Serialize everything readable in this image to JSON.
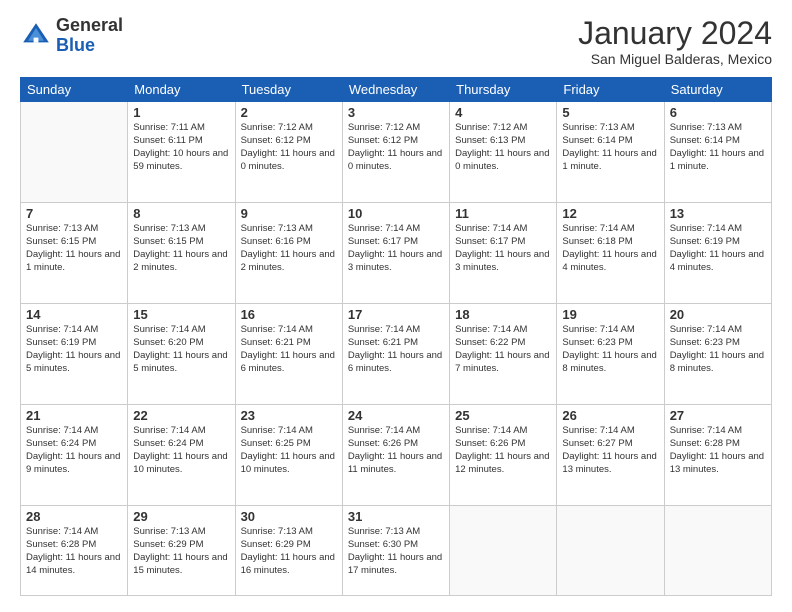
{
  "logo": {
    "general": "General",
    "blue": "Blue"
  },
  "header": {
    "month": "January 2024",
    "location": "San Miguel Balderas, Mexico"
  },
  "days": [
    "Sunday",
    "Monday",
    "Tuesday",
    "Wednesday",
    "Thursday",
    "Friday",
    "Saturday"
  ],
  "weeks": [
    [
      {
        "num": "",
        "info": ""
      },
      {
        "num": "1",
        "info": "Sunrise: 7:11 AM\nSunset: 6:11 PM\nDaylight: 10 hours\nand 59 minutes."
      },
      {
        "num": "2",
        "info": "Sunrise: 7:12 AM\nSunset: 6:12 PM\nDaylight: 11 hours\nand 0 minutes."
      },
      {
        "num": "3",
        "info": "Sunrise: 7:12 AM\nSunset: 6:12 PM\nDaylight: 11 hours\nand 0 minutes."
      },
      {
        "num": "4",
        "info": "Sunrise: 7:12 AM\nSunset: 6:13 PM\nDaylight: 11 hours\nand 0 minutes."
      },
      {
        "num": "5",
        "info": "Sunrise: 7:13 AM\nSunset: 6:14 PM\nDaylight: 11 hours\nand 1 minute."
      },
      {
        "num": "6",
        "info": "Sunrise: 7:13 AM\nSunset: 6:14 PM\nDaylight: 11 hours\nand 1 minute."
      }
    ],
    [
      {
        "num": "7",
        "info": "Sunrise: 7:13 AM\nSunset: 6:15 PM\nDaylight: 11 hours\nand 1 minute."
      },
      {
        "num": "8",
        "info": "Sunrise: 7:13 AM\nSunset: 6:15 PM\nDaylight: 11 hours\nand 2 minutes."
      },
      {
        "num": "9",
        "info": "Sunrise: 7:13 AM\nSunset: 6:16 PM\nDaylight: 11 hours\nand 2 minutes."
      },
      {
        "num": "10",
        "info": "Sunrise: 7:14 AM\nSunset: 6:17 PM\nDaylight: 11 hours\nand 3 minutes."
      },
      {
        "num": "11",
        "info": "Sunrise: 7:14 AM\nSunset: 6:17 PM\nDaylight: 11 hours\nand 3 minutes."
      },
      {
        "num": "12",
        "info": "Sunrise: 7:14 AM\nSunset: 6:18 PM\nDaylight: 11 hours\nand 4 minutes."
      },
      {
        "num": "13",
        "info": "Sunrise: 7:14 AM\nSunset: 6:19 PM\nDaylight: 11 hours\nand 4 minutes."
      }
    ],
    [
      {
        "num": "14",
        "info": "Sunrise: 7:14 AM\nSunset: 6:19 PM\nDaylight: 11 hours\nand 5 minutes."
      },
      {
        "num": "15",
        "info": "Sunrise: 7:14 AM\nSunset: 6:20 PM\nDaylight: 11 hours\nand 5 minutes."
      },
      {
        "num": "16",
        "info": "Sunrise: 7:14 AM\nSunset: 6:21 PM\nDaylight: 11 hours\nand 6 minutes."
      },
      {
        "num": "17",
        "info": "Sunrise: 7:14 AM\nSunset: 6:21 PM\nDaylight: 11 hours\nand 6 minutes."
      },
      {
        "num": "18",
        "info": "Sunrise: 7:14 AM\nSunset: 6:22 PM\nDaylight: 11 hours\nand 7 minutes."
      },
      {
        "num": "19",
        "info": "Sunrise: 7:14 AM\nSunset: 6:23 PM\nDaylight: 11 hours\nand 8 minutes."
      },
      {
        "num": "20",
        "info": "Sunrise: 7:14 AM\nSunset: 6:23 PM\nDaylight: 11 hours\nand 8 minutes."
      }
    ],
    [
      {
        "num": "21",
        "info": "Sunrise: 7:14 AM\nSunset: 6:24 PM\nDaylight: 11 hours\nand 9 minutes."
      },
      {
        "num": "22",
        "info": "Sunrise: 7:14 AM\nSunset: 6:24 PM\nDaylight: 11 hours\nand 10 minutes."
      },
      {
        "num": "23",
        "info": "Sunrise: 7:14 AM\nSunset: 6:25 PM\nDaylight: 11 hours\nand 10 minutes."
      },
      {
        "num": "24",
        "info": "Sunrise: 7:14 AM\nSunset: 6:26 PM\nDaylight: 11 hours\nand 11 minutes."
      },
      {
        "num": "25",
        "info": "Sunrise: 7:14 AM\nSunset: 6:26 PM\nDaylight: 11 hours\nand 12 minutes."
      },
      {
        "num": "26",
        "info": "Sunrise: 7:14 AM\nSunset: 6:27 PM\nDaylight: 11 hours\nand 13 minutes."
      },
      {
        "num": "27",
        "info": "Sunrise: 7:14 AM\nSunset: 6:28 PM\nDaylight: 11 hours\nand 13 minutes."
      }
    ],
    [
      {
        "num": "28",
        "info": "Sunrise: 7:14 AM\nSunset: 6:28 PM\nDaylight: 11 hours\nand 14 minutes."
      },
      {
        "num": "29",
        "info": "Sunrise: 7:13 AM\nSunset: 6:29 PM\nDaylight: 11 hours\nand 15 minutes."
      },
      {
        "num": "30",
        "info": "Sunrise: 7:13 AM\nSunset: 6:29 PM\nDaylight: 11 hours\nand 16 minutes."
      },
      {
        "num": "31",
        "info": "Sunrise: 7:13 AM\nSunset: 6:30 PM\nDaylight: 11 hours\nand 17 minutes."
      },
      {
        "num": "",
        "info": ""
      },
      {
        "num": "",
        "info": ""
      },
      {
        "num": "",
        "info": ""
      }
    ]
  ]
}
